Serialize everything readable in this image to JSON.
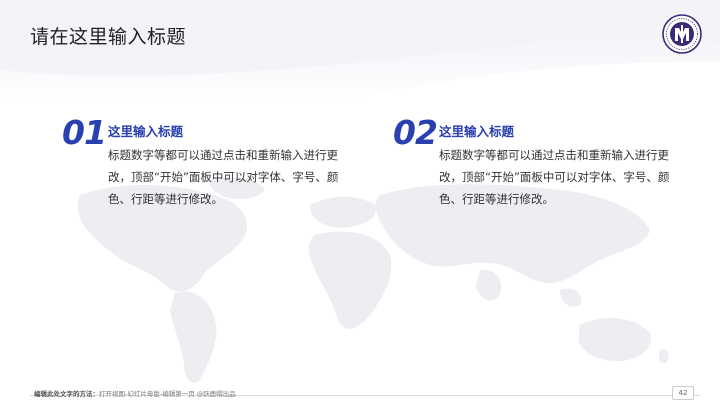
{
  "slide": {
    "title": "请在这里输入标题",
    "blocks": [
      {
        "number": "01",
        "heading": "这里输入标题",
        "body": "标题数字等都可以通过点击和重新输入进行更改，顶部“开始”面板中可以对字体、字号、颜色、行距等进行修改。"
      },
      {
        "number": "02",
        "heading": "这里输入标题",
        "body": "标题数字等都可以通过点击和重新输入进行更改，顶部“开始”面板中可以对字体、字号、颜色、行距等进行修改。"
      }
    ],
    "footer": {
      "lead": "编辑此处文字的方法：",
      "text": "打开视图-幻灯片母版-编辑第一页 @跃鹿帽出品"
    },
    "page_number": "42"
  },
  "colors": {
    "accent": "#2a3fb0",
    "title": "#222222",
    "body": "#333333",
    "seal": "#3b2a78"
  },
  "icons": {
    "seal": "university-seal-icon",
    "background": "world-map-icon"
  }
}
